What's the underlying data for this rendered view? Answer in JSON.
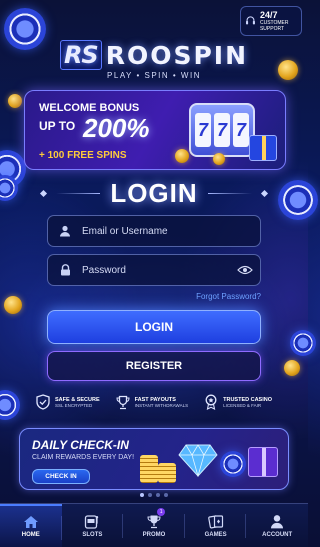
{
  "support": {
    "title": "24/7",
    "subtitle": "CUSTOMER SUPPORT",
    "icon": "headset-icon"
  },
  "brand": {
    "mark": "RS",
    "name": "ROOSPIN",
    "tagline": "PLAY • SPIN • WIN"
  },
  "bonus": {
    "line1": "WELCOME BONUS",
    "line2": "UP TO",
    "percent": "200%",
    "line3": "+ 100 FREE SPINS",
    "reels": [
      "7",
      "7",
      "7"
    ]
  },
  "login": {
    "title": "LOGIN",
    "username_placeholder": "Email or Username",
    "password_placeholder": "Password",
    "forgot_label": "Forgot Password?",
    "login_label": "LOGIN",
    "register_label": "REGISTER"
  },
  "badges": [
    {
      "title": "SAFE & SECURE",
      "subtitle": "SSL ENCRYPTED",
      "icon": "shield-check-icon"
    },
    {
      "title": "FAST PAYOUTS",
      "subtitle": "INSTANT WITHDRAWALS",
      "icon": "trophy-icon"
    },
    {
      "title": "TRUSTED CASINO",
      "subtitle": "LICENSED & FAIR",
      "icon": "medal-icon"
    }
  ],
  "checkin": {
    "title": "DAILY CHECK-IN",
    "subtitle": "CLAIM REWARDS EVERY DAY!",
    "button": "CHECK IN"
  },
  "carousel": {
    "count": 4,
    "active": 1
  },
  "nav": {
    "tabs": [
      {
        "label": "HOME",
        "icon": "home-icon",
        "active": true
      },
      {
        "label": "SLOTS",
        "icon": "slot-machine-icon"
      },
      {
        "label": "PROMO",
        "icon": "trophy-icon",
        "badge": "1"
      },
      {
        "label": "GAMES",
        "icon": "cards-icon"
      },
      {
        "label": "ACCOUNT",
        "icon": "user-icon"
      }
    ]
  },
  "colors": {
    "accent": "#3f6dff",
    "gold": "#ffcb3a",
    "link": "#6fa2ff",
    "register_border": "#8f6bff"
  }
}
